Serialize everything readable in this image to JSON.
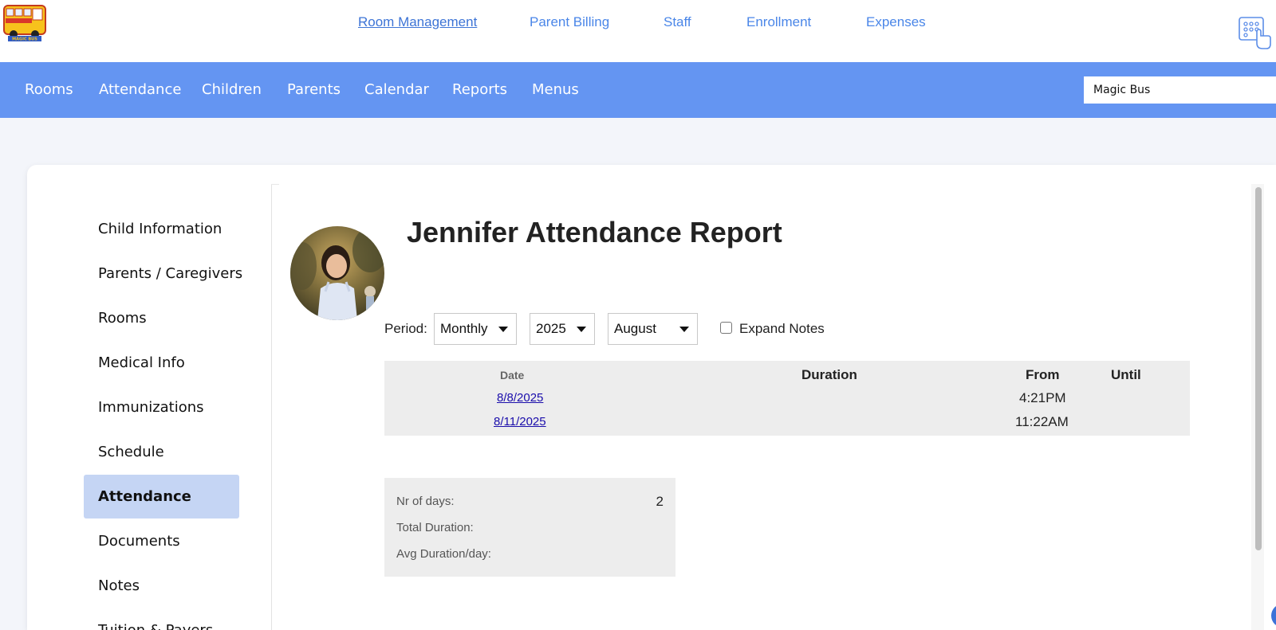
{
  "top_nav": {
    "logo_text": "MAGIC BUS",
    "links": [
      {
        "label": "Room Management",
        "active": true
      },
      {
        "label": "Parent Billing"
      },
      {
        "label": "Staff"
      },
      {
        "label": "Enrollment"
      },
      {
        "label": "Expenses"
      }
    ],
    "apps_icon": "app-grid-touch-icon"
  },
  "main_nav": {
    "items": [
      "Rooms",
      "Attendance",
      "Children",
      "Parents",
      "Calendar",
      "Reports",
      "Menus"
    ],
    "school_select": "Magic Bus"
  },
  "sidebar": {
    "items": [
      "Child Information",
      "Parents / Caregivers",
      "Rooms",
      "Medical Info",
      "Immunizations",
      "Schedule",
      "Attendance",
      "Documents",
      "Notes",
      "Tuition & Payers"
    ],
    "active_index": 6
  },
  "report": {
    "title": "Jennifer Attendance Report",
    "period_label": "Period:",
    "period_value": "Monthly",
    "year_value": "2025",
    "month_value": "August",
    "expand_notes_label": "Expand Notes",
    "expand_notes_checked": false,
    "columns": {
      "date": "Date",
      "duration": "Duration",
      "from": "From",
      "until": "Until"
    },
    "rows": [
      {
        "date": "8/8/2025",
        "duration": "",
        "from": "4:21PM",
        "until": ""
      },
      {
        "date": "8/11/2025",
        "duration": "",
        "from": "11:22AM",
        "until": ""
      }
    ],
    "summary": {
      "nr_days_label": "Nr of days:",
      "nr_days_value": "2",
      "total_duration_label": "Total Duration:",
      "total_duration_value": "",
      "avg_duration_label": "Avg Duration/day:",
      "avg_duration_value": ""
    }
  },
  "colors": {
    "nav_blue": "#6495f2",
    "link_blue": "#4a86e8",
    "active_sidebar": "#c5d5f4",
    "table_bg": "#ededed"
  }
}
